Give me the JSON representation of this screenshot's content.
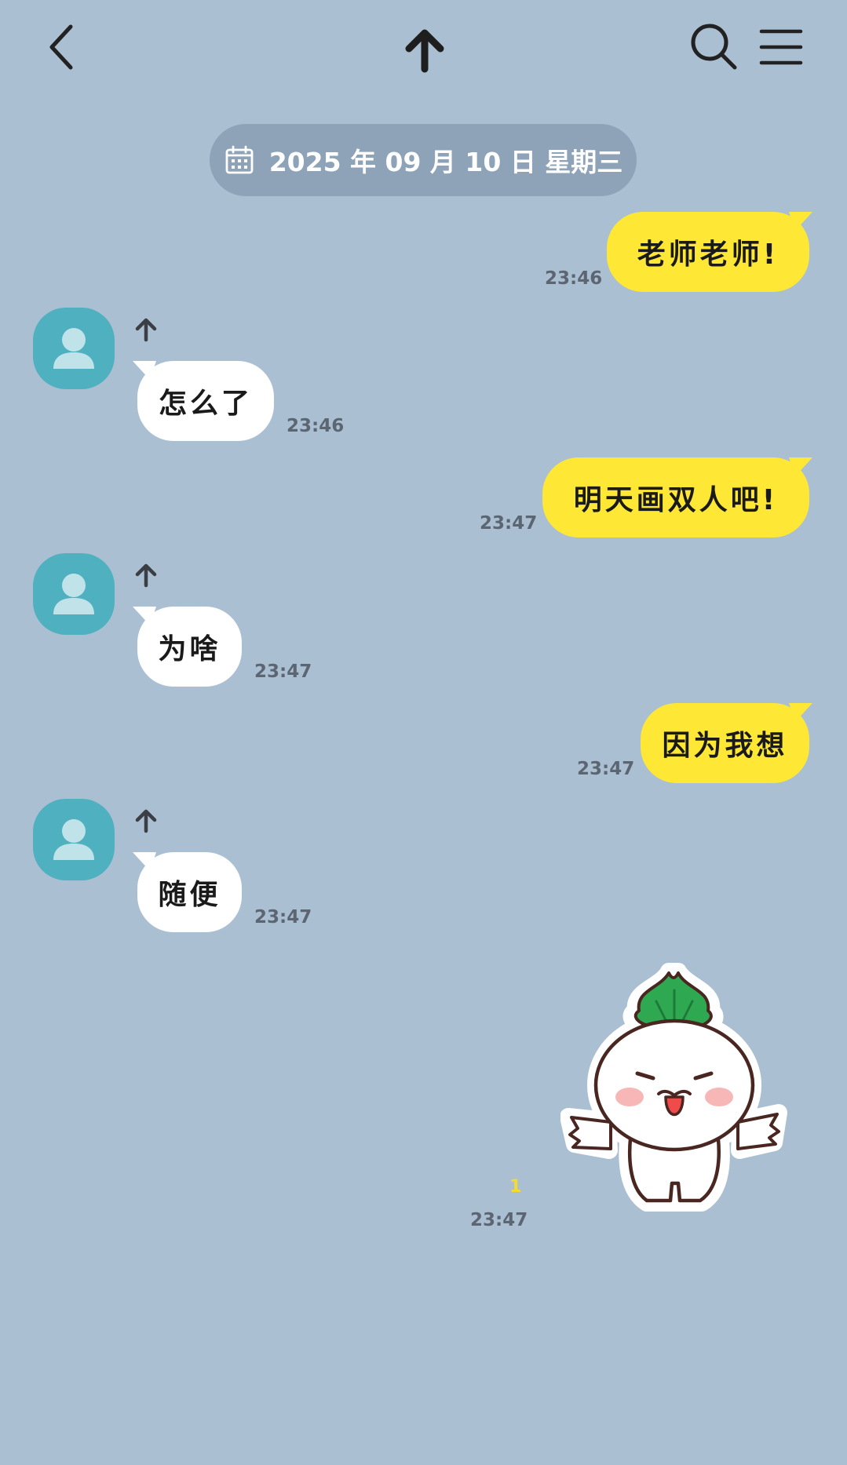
{
  "header": {
    "back_icon": "chevron-left-icon",
    "title_icon": "arrow-up-icon",
    "search_icon": "search-icon",
    "menu_icon": "hamburger-menu-icon"
  },
  "date_divider": {
    "icon": "calendar-icon",
    "text": "2025 年 09 月 10 日  星期三"
  },
  "messages": [
    {
      "direction": "out",
      "text": "老师老师!",
      "time": "23:46"
    },
    {
      "direction": "in",
      "sender_icon": "arrow-up-icon",
      "text": "怎么了",
      "time": "23:46"
    },
    {
      "direction": "out",
      "text": "明天画双人吧!",
      "time": "23:47"
    },
    {
      "direction": "in",
      "sender_icon": "arrow-up-icon",
      "text": "为啥",
      "time": "23:47"
    },
    {
      "direction": "out",
      "text": "因为我想",
      "time": "23:47"
    },
    {
      "direction": "in",
      "sender_icon": "arrow-up-icon",
      "text": "随便",
      "time": "23:47"
    },
    {
      "direction": "out",
      "type": "sticker",
      "sticker": "radish-character-sticker",
      "unread_count": "1",
      "time": "23:47"
    }
  ],
  "colors": {
    "background": "#abbfd3",
    "outgoing_bubble": "#fee735",
    "incoming_bubble": "#ffffff",
    "avatar": "#4fb0bf",
    "date_pill": "#8ea3b7",
    "unread": "#f4dc2c"
  }
}
